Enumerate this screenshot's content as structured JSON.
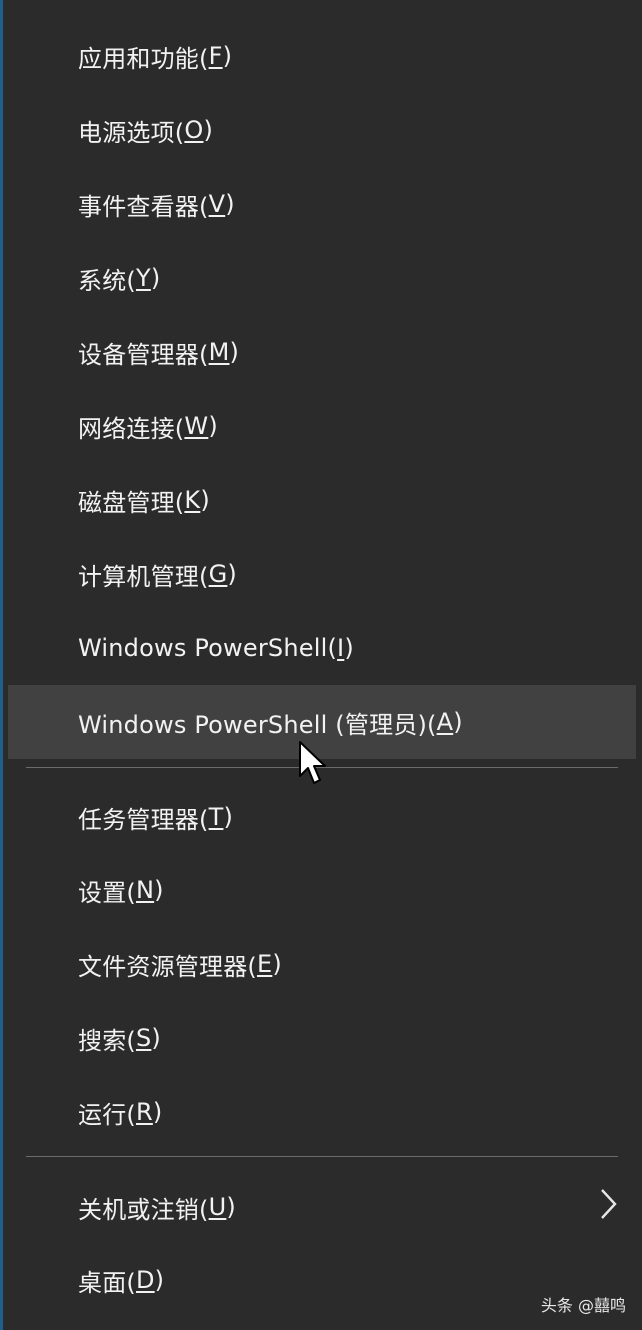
{
  "menu": {
    "items": [
      {
        "label": "应用和功能(",
        "key": "F",
        "close": ")"
      },
      {
        "label": "电源选项(",
        "key": "O",
        "close": ")"
      },
      {
        "label": "事件查看器(",
        "key": "V",
        "close": ")"
      },
      {
        "label": "系统(",
        "key": "Y",
        "close": ")"
      },
      {
        "label": "设备管理器(",
        "key": "M",
        "close": ")"
      },
      {
        "label": "网络连接(",
        "key": "W",
        "close": ")"
      },
      {
        "label": "磁盘管理(",
        "key": "K",
        "close": ")"
      },
      {
        "label": "计算机管理(",
        "key": "G",
        "close": ")"
      },
      {
        "label": "Windows PowerShell(",
        "key": "I",
        "close": ")"
      },
      {
        "label": "Windows PowerShell (管理员)(",
        "key": "A",
        "close": ")"
      },
      {
        "label": "任务管理器(",
        "key": "T",
        "close": ")"
      },
      {
        "label": "设置(",
        "key": "N",
        "close": ")"
      },
      {
        "label": "文件资源管理器(",
        "key": "E",
        "close": ")"
      },
      {
        "label": "搜索(",
        "key": "S",
        "close": ")"
      },
      {
        "label": "运行(",
        "key": "R",
        "close": ")"
      },
      {
        "label": "关机或注销(",
        "key": "U",
        "close": ")"
      },
      {
        "label": "桌面(",
        "key": "D",
        "close": ")"
      }
    ]
  },
  "icons": {
    "submenu": "chevron-right-icon",
    "pointer": "mouse-cursor-icon"
  },
  "colors": {
    "background": "#2b2b2b",
    "highlight": "#414141",
    "text": "#f2f2f2",
    "separator": "#6b6b6b"
  },
  "watermark": {
    "text": "头条 @囍鸣"
  }
}
